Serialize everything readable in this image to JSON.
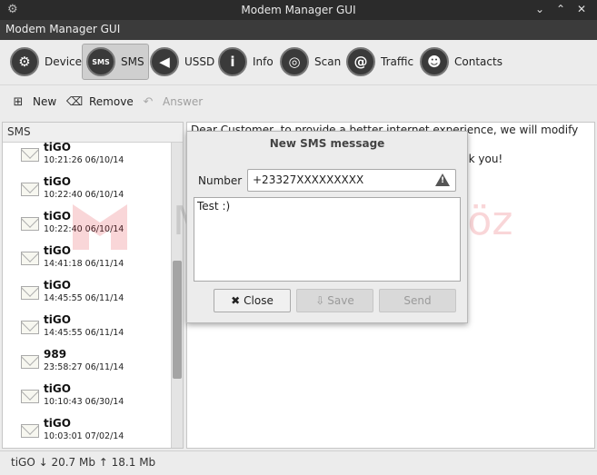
{
  "window": {
    "title": "Modem Manager GUI"
  },
  "menubar": {
    "label": "Modem Manager GUI"
  },
  "nav": [
    {
      "label": "Devices",
      "icon": "modem-icon"
    },
    {
      "label": "SMS",
      "icon": "sms-icon",
      "glyph": "SMS"
    },
    {
      "label": "USSD",
      "icon": "ussd-icon"
    },
    {
      "label": "Info",
      "icon": "info-icon",
      "glyph": "i"
    },
    {
      "label": "Scan",
      "icon": "scan-icon"
    },
    {
      "label": "Traffic",
      "icon": "traffic-icon",
      "glyph": "@"
    },
    {
      "label": "Contacts",
      "icon": "contacts-icon"
    }
  ],
  "actions": {
    "new_label": "New",
    "remove_label": "Remove",
    "answer_label": "Answer"
  },
  "sms_panel": {
    "header": "SMS",
    "items": [
      {
        "from": "tiGO",
        "date": "10:21:26 06/10/14"
      },
      {
        "from": "tiGO",
        "date": "10:22:40 06/10/14"
      },
      {
        "from": "tiGO",
        "date": "10:22:40 06/10/14"
      },
      {
        "from": "tiGO",
        "date": "14:41:18 06/11/14"
      },
      {
        "from": "tiGO",
        "date": "14:45:55 06/11/14"
      },
      {
        "from": "tiGO",
        "date": "14:45:55 06/11/14"
      },
      {
        "from": "989",
        "date": "23:58:27 06/11/14"
      },
      {
        "from": "tiGO",
        "date": "10:10:43 06/30/14"
      },
      {
        "from": "tiGO",
        "date": "10:03:01 07/02/14"
      }
    ]
  },
  "message_view": {
    "line1": "Dear Customer, to provide a better internet experience, we will modify our internet",
    "line2": "nk you!"
  },
  "watermark": {
    "left_text": "Mertcan",
    "right_text": "Gökgöz"
  },
  "dialog": {
    "title": "New SMS message",
    "number_label": "Number",
    "number_value": "+23327XXXXXXXXX",
    "message_text": "Test :)",
    "close_label": "Close",
    "save_label": "Save",
    "send_label": "Send"
  },
  "status": {
    "text": "tiGO ↓ 20.7 Mb ↑ 18.1 Mb"
  }
}
